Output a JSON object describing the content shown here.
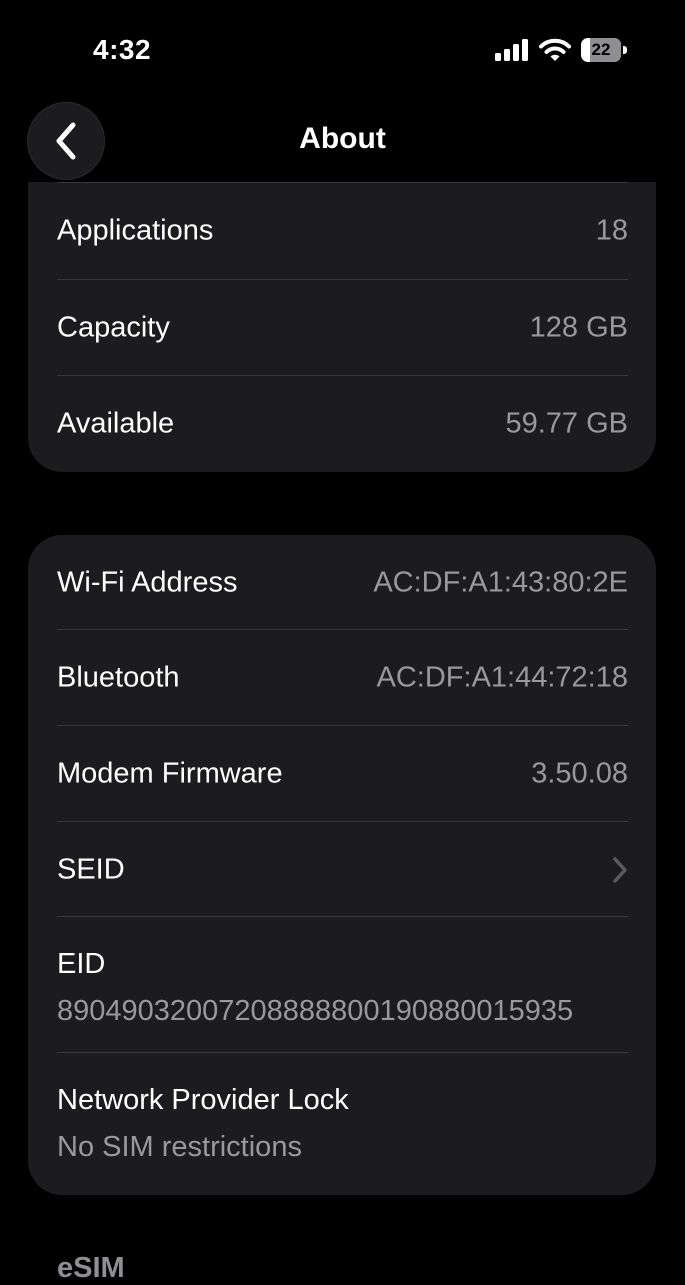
{
  "status_bar": {
    "time": "4:32",
    "battery_level": "22",
    "icons": [
      "signal-icon",
      "wifi-icon",
      "battery-icon"
    ]
  },
  "nav": {
    "title": "About",
    "back_icon": "chevron-left-icon"
  },
  "storage_group": {
    "rows": [
      {
        "label": "Applications",
        "value": "18"
      },
      {
        "label": "Capacity",
        "value": "128 GB"
      },
      {
        "label": "Available",
        "value": "59.77 GB"
      }
    ]
  },
  "network_group": {
    "wifi": {
      "label": "Wi-Fi Address",
      "value": "AC:DF:A1:43:80:2E"
    },
    "bluetooth": {
      "label": "Bluetooth",
      "value": "AC:DF:A1:44:72:18"
    },
    "modem": {
      "label": "Modem Firmware",
      "value": "3.50.08"
    },
    "seid": {
      "label": "SEID",
      "icon": "chevron-right-icon"
    },
    "eid": {
      "label": "EID",
      "value": "89049032007208888800190880015935"
    },
    "lock": {
      "label": "Network Provider Lock",
      "value": "No SIM restrictions"
    }
  },
  "esim_header": "eSIM",
  "colors": {
    "background": "#000000",
    "group_background": "#1c1c1e",
    "separator": "#38383a",
    "secondary_text": "#98989e"
  }
}
